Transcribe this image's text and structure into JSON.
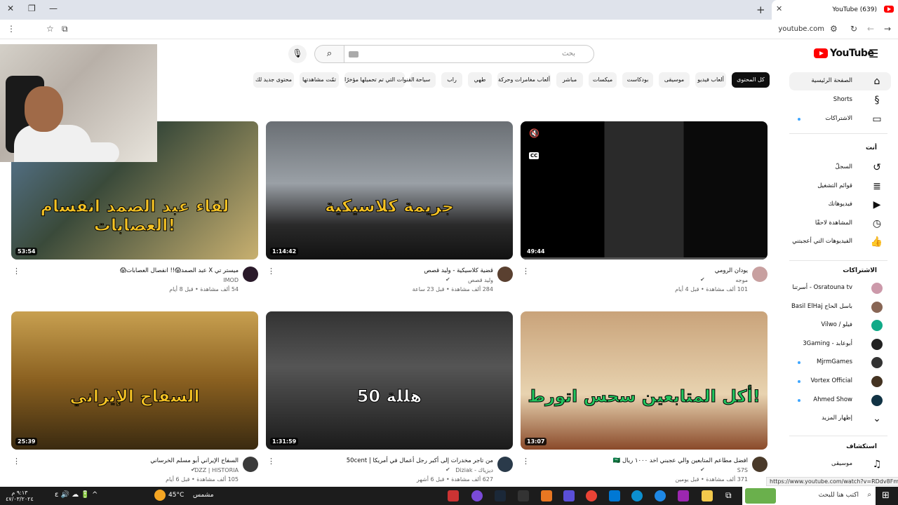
{
  "browser": {
    "tab_title": "(639) YouTube",
    "url": "youtube.com",
    "status_url": "https://www.youtube.com/watch?v=RDdv8FmEU8M"
  },
  "header": {
    "logo_text": "YouTube",
    "search_placeholder": "بحث"
  },
  "chips": [
    {
      "label": "كل المحتوى",
      "active": true
    },
    {
      "label": "ألعاب فيديو"
    },
    {
      "label": "موسيقى"
    },
    {
      "label": "بودكاست"
    },
    {
      "label": "ميكسات"
    },
    {
      "label": "مباشر"
    },
    {
      "label": "ألعاب مغامرات وحركة"
    },
    {
      "label": "طهي"
    },
    {
      "label": "راب"
    },
    {
      "label": "سياحة"
    },
    {
      "label": "القنوات التي تم تحميلها مؤخرًا"
    },
    {
      "label": "تمّت مشاهدتها"
    },
    {
      "label": "محتوى جديد لك"
    }
  ],
  "sidebar": {
    "main": [
      {
        "label": "الصفحة الرئيسية",
        "icon": "home-icon",
        "glyph": "⌂"
      },
      {
        "label": "Shorts",
        "icon": "shorts-icon",
        "glyph": "§"
      },
      {
        "label": "الاشتراكات",
        "icon": "subscriptions-icon",
        "glyph": "▭"
      }
    ],
    "you_heading": "أنت",
    "you": [
      {
        "label": "السجلّ",
        "icon": "history-icon",
        "glyph": "↺"
      },
      {
        "label": "قوائم التشغيل",
        "icon": "playlists-icon",
        "glyph": "≣"
      },
      {
        "label": "فيديوهاتك",
        "icon": "your-videos-icon",
        "glyph": "▶"
      },
      {
        "label": "المشاهدة لاحقًا",
        "icon": "watch-later-icon",
        "glyph": "◷"
      },
      {
        "label": "الفيديوهات التي أعجبتني",
        "icon": "liked-videos-icon",
        "glyph": "👍"
      }
    ],
    "subs_heading": "الاشتراكات",
    "subs": [
      {
        "label": "Osratouna tv - أسرتنا",
        "color": "#c9a",
        "dot": false
      },
      {
        "label": "باسل الحاج Basil ElHaj",
        "color": "#865",
        "dot": false
      },
      {
        "label": "فيلو / Vilwo",
        "color": "#1a8",
        "dot": false
      },
      {
        "label": "أبوعابد - 3Gaming",
        "color": "#222",
        "dot": false
      },
      {
        "label": "MjrmGames",
        "color": "#333",
        "dot": true
      },
      {
        "label": "Vortex Official",
        "color": "#432",
        "dot": true
      },
      {
        "label": "Ahmed Show",
        "color": "#134",
        "dot": true
      }
    ],
    "show_more": "إظهار المزيد",
    "explore_heading": "استكشاف",
    "explore": [
      {
        "label": "موسيقى",
        "icon": "music-icon",
        "glyph": "♫"
      }
    ]
  },
  "videos": [
    {
      "title": "يودان الرومي",
      "channel": "موجه",
      "meta": "101 ألف مشاهدة • قبل 4 أيام",
      "duration": "49:44",
      "avatar": "#c8a0a0",
      "verified": true
    },
    {
      "title": "قضية كلاسيكية - وليد قصص",
      "channel": "وليد قصص",
      "meta": "284 ألف مشاهدة • قبل 23 ساعة",
      "duration": "1:14:42",
      "thumb_text": "جريمة كلاسيكية",
      "avatar": "#5a4030",
      "verified": true
    },
    {
      "title": "ميستر تي X عبد الصمد😱!! انفصال العصابات😱",
      "channel": "IMOD",
      "meta": "54 ألف مشاهدة • قبل 8 أيام",
      "duration": "53:54",
      "thumb_text": "لقاء عبد الصمد انقسام العصابات!",
      "avatar": "#2a1a2a",
      "verified": false
    },
    {
      "title": "افضل مطاعم المتابعين والي عجبني اخد ١٠٠٠ ريال 🇸🇦",
      "channel": "S7S",
      "meta": "371 ألف مشاهدة • قبل يومين",
      "duration": "13:07",
      "thumb_text": "أكل المتابعين سحس اتورط!",
      "avatar": "#4a3a2a",
      "verified": true
    },
    {
      "title": "من تاجر مخدرات إلى أكبر رجل أعمال في أمريكا | 50cent",
      "channel": "ديزياك - Diziak",
      "meta": "627 ألف مشاهدة • قبل 6 أشهر",
      "duration": "1:31:59",
      "thumb_text": "50 هللة",
      "avatar": "#2a3a4a",
      "verified": true
    },
    {
      "title": "السفاح الإيراني أبو مسلم الخرساني",
      "channel": "DZZ | HISTORIA",
      "meta": "105 ألف مشاهدة • قبل 6 أيام",
      "duration": "25:39",
      "thumb_text": "السفاح الإيراني",
      "avatar": "#3a3a3a",
      "verified": true
    }
  ],
  "taskbar": {
    "search_placeholder": "اكتب هنا للبحث",
    "weather": "45°C",
    "weather_text": "مشمس",
    "time": "٩:١٣ م",
    "date": "٤٧/٠٣/٢٠٢٤"
  }
}
